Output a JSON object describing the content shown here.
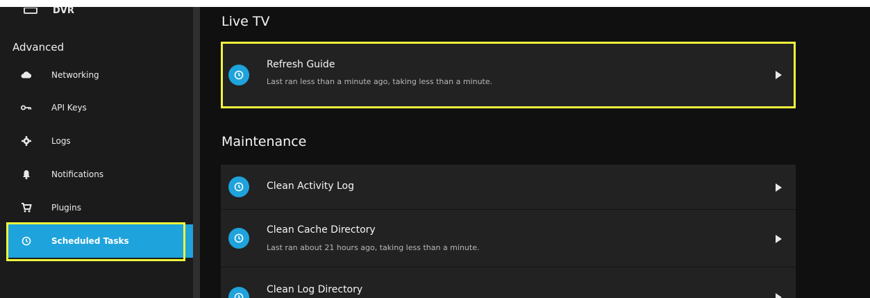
{
  "sidebar": {
    "top_item": {
      "label": "DVR",
      "icon": "dvr-icon"
    },
    "section_label": "Advanced",
    "items": [
      {
        "label": "Networking",
        "icon": "cloud-icon"
      },
      {
        "label": "API Keys",
        "icon": "key-icon"
      },
      {
        "label": "Logs",
        "icon": "gear-icon"
      },
      {
        "label": "Notifications",
        "icon": "bell-icon"
      },
      {
        "label": "Plugins",
        "icon": "cart-icon"
      },
      {
        "label": "Scheduled Tasks",
        "icon": "clock-icon",
        "active": true
      }
    ]
  },
  "main": {
    "sections": [
      {
        "title": "Live TV",
        "tasks": [
          {
            "name": "Refresh Guide",
            "status": "Last ran less than a minute ago, taking less than a minute."
          }
        ]
      },
      {
        "title": "Maintenance",
        "tasks": [
          {
            "name": "Clean Activity Log",
            "status": ""
          },
          {
            "name": "Clean Cache Directory",
            "status": "Last ran about 21 hours ago, taking less than a minute."
          },
          {
            "name": "Clean Log Directory",
            "status": ""
          }
        ]
      }
    ]
  },
  "colors": {
    "accent": "#1ea3dc",
    "highlight": "#f1f53c",
    "sidebar_bg": "#1b1b1b",
    "main_bg": "#101010",
    "card_bg": "#222222"
  }
}
